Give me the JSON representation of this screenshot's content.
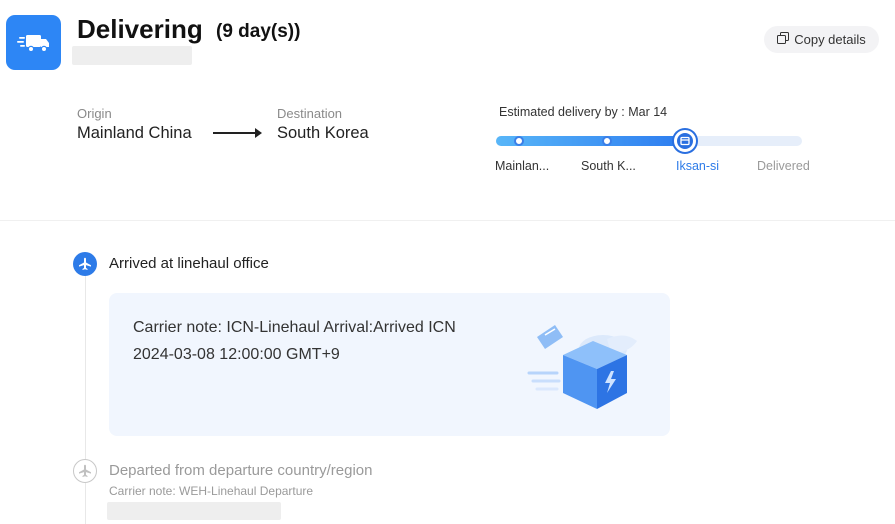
{
  "header": {
    "title": "Delivering",
    "duration": "(9 day(s))",
    "copy_button": "Copy details",
    "icons": {
      "status": "truck-icon",
      "copy": "copy-icon"
    }
  },
  "route": {
    "origin_label": "Origin",
    "origin": "Mainland China",
    "destination_label": "Destination",
    "destination": "South Korea"
  },
  "progress": {
    "estimated": "Estimated delivery by : Mar 14",
    "steps": [
      {
        "label": "Mainlan..."
      },
      {
        "label": "South K..."
      },
      {
        "label": "Iksan-si"
      },
      {
        "label": "Delivered"
      }
    ],
    "current_step": 3,
    "total_steps": 4,
    "accent": "#2d7be8"
  },
  "events": [
    {
      "title": "Arrived at linehaul office",
      "note": "Carrier note: ICN-Linehaul Arrival:Arrived ICN",
      "time": "2024-03-08 12:00:00 GMT+9",
      "icon": "airplane-icon",
      "state": "current"
    },
    {
      "title": "Departed from departure country/region",
      "note": "Carrier note: WEH-Linehaul Departure",
      "icon": "airplane-icon",
      "state": "past"
    }
  ]
}
